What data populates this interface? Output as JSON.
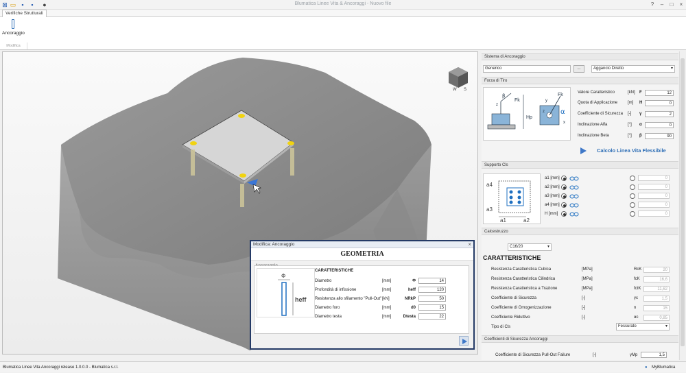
{
  "app": {
    "title": "Blumatica Linee Vita & Ancoraggi - Nuovo file"
  },
  "ribbon": {
    "tab": "Verifiche Strutturali",
    "button_label": "Ancoraggio",
    "group_label": "Modifica"
  },
  "dialog": {
    "title": "Modifica: Ancoraggio",
    "heading": "GEOMETRIA",
    "tab": "Ancoraggio",
    "section": "CARATTERISTICHE",
    "image_label": "heff",
    "image_symbol": "Φ",
    "rows": [
      {
        "label": "Diametro",
        "unit": "[mm]",
        "symbol": "Φ",
        "value": "14"
      },
      {
        "label": "Profondità di infissione",
        "unit": "[mm]",
        "symbol": "heff",
        "value": "120"
      },
      {
        "label": "Resistenza allo sfilamento \"Pull-Out\"",
        "unit": "[kN]",
        "symbol": "NRkP",
        "value": "50"
      },
      {
        "label": "Diametro foro",
        "unit": "[mm]",
        "symbol": "d0",
        "value": "15"
      },
      {
        "label": "Diametro testa",
        "unit": "[mm]",
        "symbol": "Dtesta",
        "value": "22"
      }
    ]
  },
  "panel": {
    "sistema": {
      "header": "Sistema di Ancoraggio",
      "type_value": "Generico",
      "browse": "...",
      "aggancio": "Aggancio Diretto"
    },
    "forza": {
      "header": "Forza di Tiro",
      "diagram_labels": {
        "beta": "β",
        "fk": "Fk",
        "alpha": "α",
        "hp": "Hp",
        "z": "z",
        "x": "x",
        "y": "y"
      },
      "rows": [
        {
          "label": "Valore Caratteristico",
          "unit": "[kN]",
          "symbol": "F",
          "value": "12"
        },
        {
          "label": "Quota di Applicazione",
          "unit": "[m]",
          "symbol": "H",
          "value": "0"
        },
        {
          "label": "Coefficiente di Sicurezza",
          "unit": "[-]",
          "symbol": "γ",
          "value": "2"
        },
        {
          "label": "Inclinazione Alfa",
          "unit": "[°]",
          "symbol": "α",
          "value": "0"
        },
        {
          "label": "Inclinazione Beta",
          "unit": "[°]",
          "symbol": "β",
          "value": "90"
        }
      ],
      "calc_button": "Calcolo Linea Vita Flessibile"
    },
    "supporto": {
      "header": "Supporto Cls",
      "diagram_labels": {
        "a1": "a1",
        "a2": "a2",
        "a3": "a3",
        "a4": "a4"
      },
      "rows": [
        {
          "label": "a1 [mm]",
          "value": "0"
        },
        {
          "label": "a2 [mm]",
          "value": "0"
        },
        {
          "label": "a3 [mm]",
          "value": "0"
        },
        {
          "label": "a4 [mm]",
          "value": "0"
        },
        {
          "label": "H [mm]",
          "value": "0"
        }
      ]
    },
    "calcestruzzo": {
      "header": "Calcestruzzo",
      "class_value": "C16/20",
      "title": "CARATTERISTICHE",
      "rows": [
        {
          "label": "Resistenza Caratteristica Cubica",
          "unit": "[MPa]",
          "symbol": "RcK",
          "value": "20"
        },
        {
          "label": "Resistenza Caratteristica Cilindrica",
          "unit": "[MPa]",
          "symbol": "fcK",
          "value": "16,6"
        },
        {
          "label": "Resistenza Caratteristica a Trazione",
          "unit": "[MPa]",
          "symbol": "fctK",
          "value": "11,62"
        },
        {
          "label": "Coefficiente di Sicurezza",
          "unit": "[-]",
          "symbol": "γc",
          "value": "1,5"
        },
        {
          "label": "Coefficiente di Omogenizzazione",
          "unit": "[-]",
          "symbol": "n",
          "value": "15"
        },
        {
          "label": "Coefficiente Riduttivo",
          "unit": "[-]",
          "symbol": "αc",
          "value": "0,85"
        }
      ],
      "tipo_label": "Tipo di Cls",
      "tipo_value": "Fessurato"
    },
    "coeff": {
      "header": "Coefficienti di Sicurezza Ancoraggi",
      "label": "Coefficiente di Sicurezza Pull-Out Failure",
      "unit": "[-]",
      "symbol": "γMp",
      "value": "1,5"
    }
  },
  "status": {
    "left": "Blumatica Linee Vita  Ancoraggi release 1.0.0.0 - Blumatica s.r.l.",
    "right": "MyBlumatica"
  },
  "colors": {
    "accent": "#2f6fb6",
    "dialog_border": "#243a66",
    "concrete": "#8d8d8d"
  }
}
